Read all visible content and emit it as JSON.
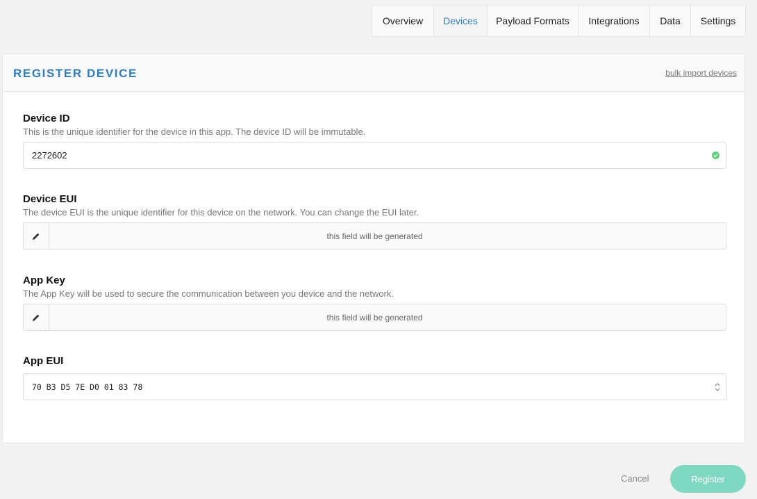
{
  "tabs": [
    {
      "label": "Overview"
    },
    {
      "label": "Devices"
    },
    {
      "label": "Payload Formats"
    },
    {
      "label": "Integrations"
    },
    {
      "label": "Data"
    },
    {
      "label": "Settings"
    }
  ],
  "active_tab": "Devices",
  "card": {
    "title": "REGISTER DEVICE",
    "bulk_link": "bulk import devices"
  },
  "fields": {
    "device_id": {
      "label": "Device ID",
      "help": "This is the unique identifier for the device in this app. The device ID will be immutable.",
      "value": "2272602",
      "status_icon": "check-circle-icon"
    },
    "device_eui": {
      "label": "Device EUI",
      "help": "The device EUI is the unique identifier for this device on the network. You can change the EUI later.",
      "placeholder": "this field will be generated",
      "edit_icon": "pencil-icon"
    },
    "app_key": {
      "label": "App Key",
      "help": "The App Key will be used to secure the communication between you device and the network.",
      "placeholder": "this field will be generated",
      "edit_icon": "pencil-icon"
    },
    "app_eui": {
      "label": "App EUI",
      "value": "70 B3 D5 7E D0 01 83 78",
      "stepper_icon": "up-down-chevron-icon"
    }
  },
  "actions": {
    "cancel": "Cancel",
    "register": "Register"
  },
  "colors": {
    "accent": "#2f7dc3",
    "success": "#5bd27a",
    "register_button": "#7fd9c2"
  }
}
